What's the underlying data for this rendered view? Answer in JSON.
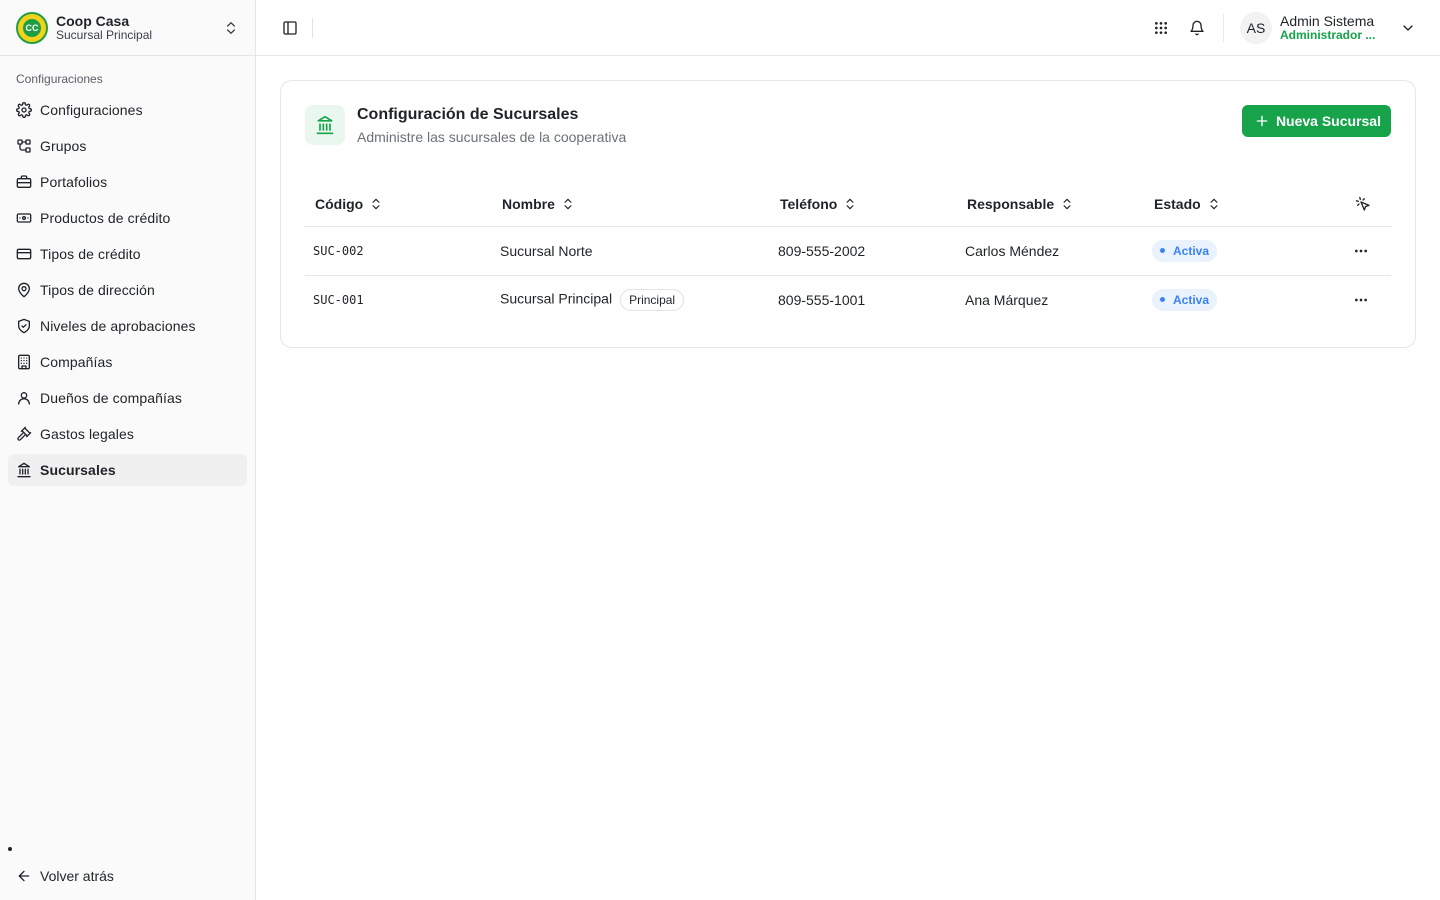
{
  "brand": {
    "name": "Coop Casa",
    "branch": "Sucursal Principal",
    "logo_text": "CC"
  },
  "sidebar": {
    "section_label": "Configuraciones",
    "items": [
      {
        "label": "Configuraciones",
        "icon": "gear-icon"
      },
      {
        "label": "Grupos",
        "icon": "network-icon"
      },
      {
        "label": "Portafolios",
        "icon": "briefcase-icon"
      },
      {
        "label": "Productos de crédito",
        "icon": "banknote-icon"
      },
      {
        "label": "Tipos de crédito",
        "icon": "credit-card-icon"
      },
      {
        "label": "Tipos de dirección",
        "icon": "map-pin-icon"
      },
      {
        "label": "Niveles de aprobaciones",
        "icon": "shield-check-icon"
      },
      {
        "label": "Compañías",
        "icon": "building-icon"
      },
      {
        "label": "Dueños de compañías",
        "icon": "user-icon"
      },
      {
        "label": "Gastos legales",
        "icon": "gavel-icon"
      },
      {
        "label": "Sucursales",
        "icon": "landmark-icon",
        "active": true
      }
    ],
    "back_label": "Volver atrás"
  },
  "topbar": {
    "user": {
      "initials": "AS",
      "name": "Admin Sistema",
      "role": "Administrador ..."
    }
  },
  "page": {
    "title": "Configuración de Sucursales",
    "subtitle": "Administre las sucursales de la cooperativa",
    "new_button": "Nueva Sucursal"
  },
  "table": {
    "columns": [
      "Código",
      "Nombre",
      "Teléfono",
      "Responsable",
      "Estado"
    ],
    "rows": [
      {
        "code": "SUC-002",
        "name": "Sucursal Norte",
        "badge": "",
        "phone": "809-555-2002",
        "manager": "Carlos Méndez",
        "status": "Activa"
      },
      {
        "code": "SUC-001",
        "name": "Sucursal Principal",
        "badge": "Principal",
        "phone": "809-555-1001",
        "manager": "Ana Márquez",
        "status": "Activa"
      }
    ]
  },
  "colors": {
    "accent": "#16a34a",
    "status_blue": "#3b82f6",
    "logo_yellow": "#f3d21b"
  }
}
